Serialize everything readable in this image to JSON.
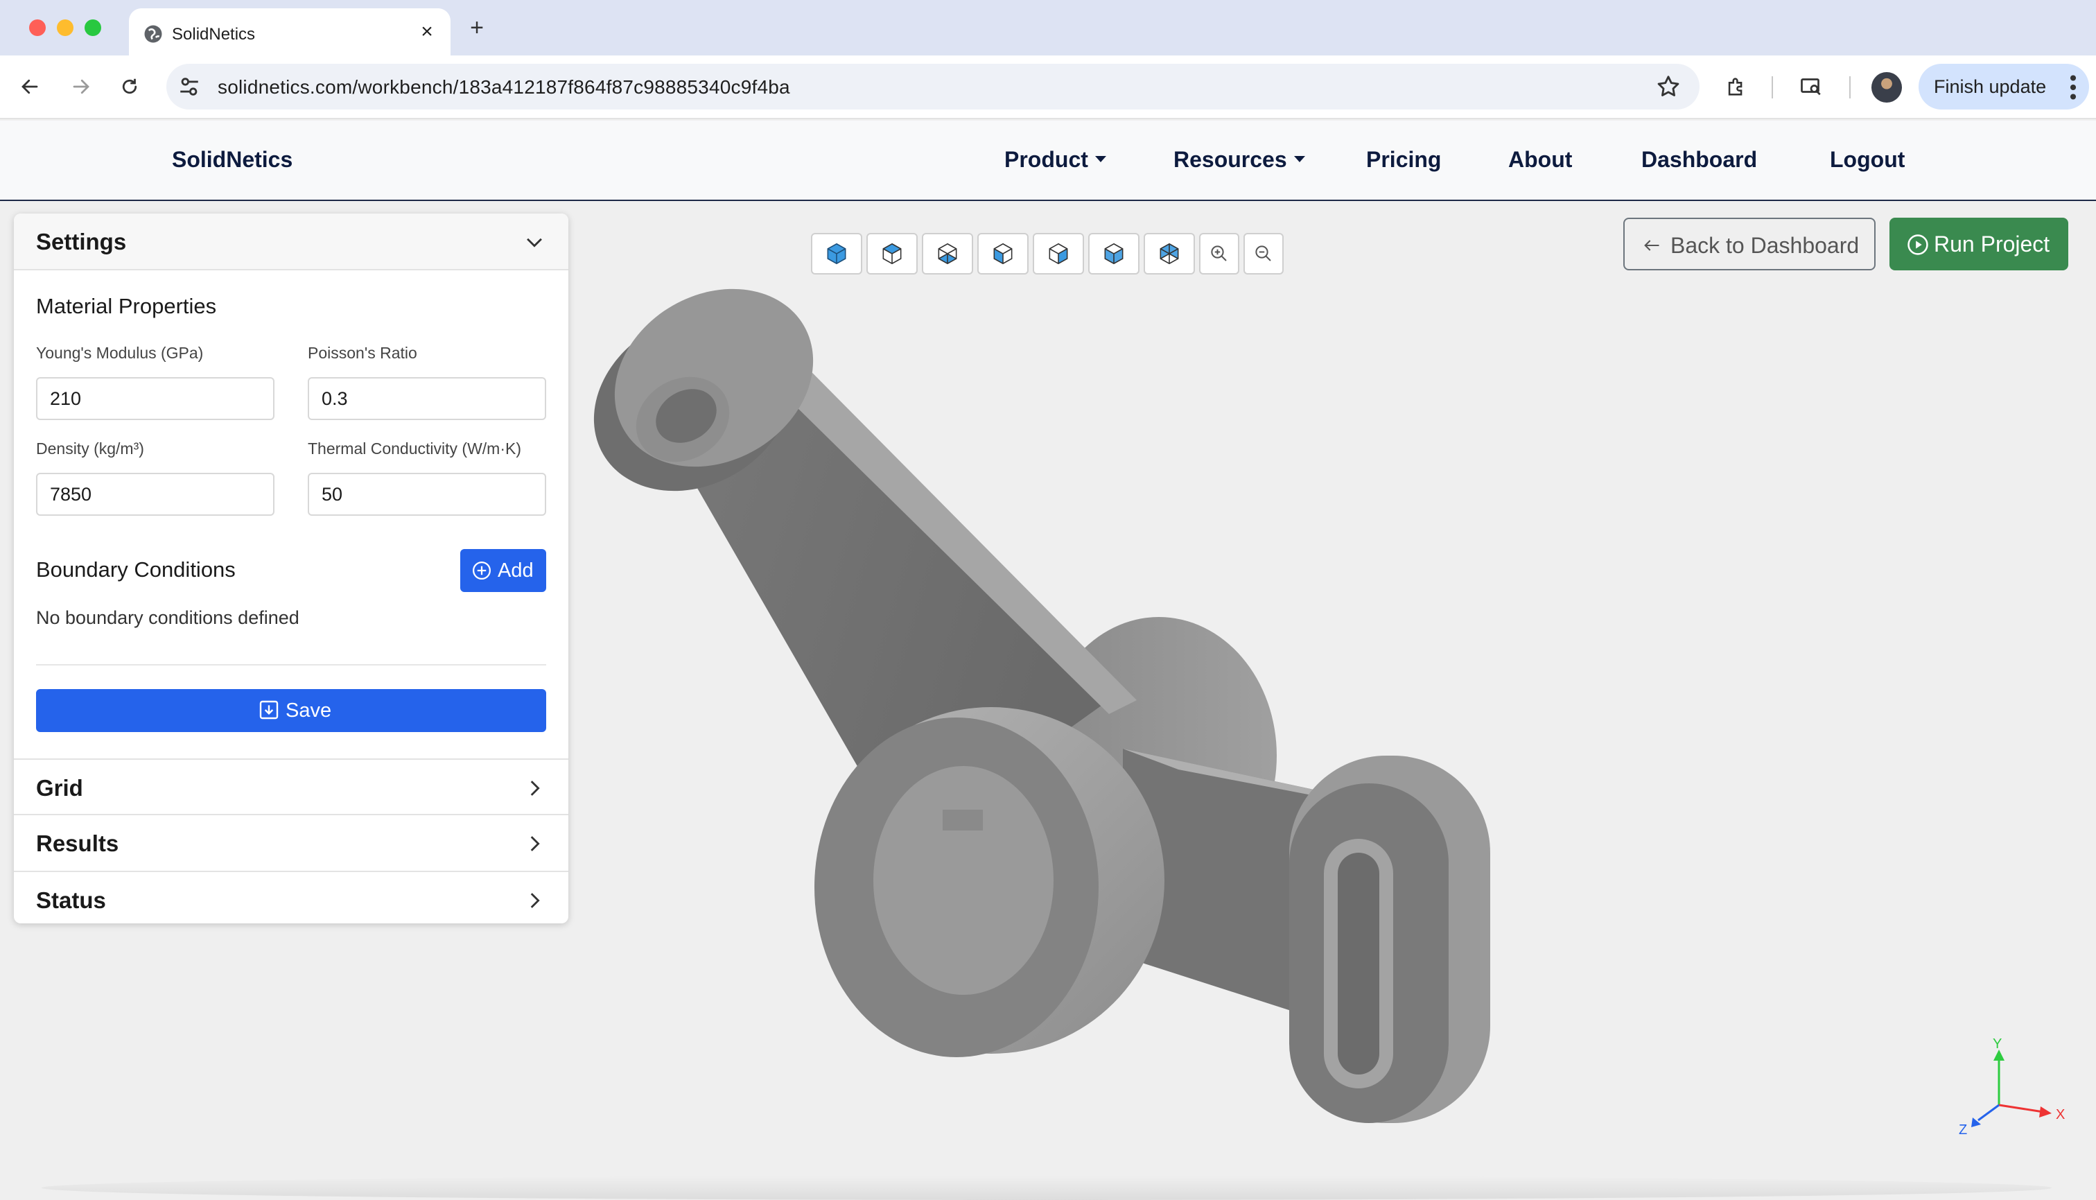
{
  "browser": {
    "tab_title": "SolidNetics",
    "url": "solidnetics.com/workbench/183a412187f864f87c98885340c9f4ba",
    "finish_update": "Finish update"
  },
  "nav": {
    "brand": "SolidNetics",
    "items": [
      "Product",
      "Resources",
      "Pricing",
      "About",
      "Dashboard",
      "Logout"
    ]
  },
  "settings": {
    "title": "Settings",
    "material_title": "Material Properties",
    "youngs_label": "Young's Modulus (GPa)",
    "youngs_value": "210",
    "poisson_label": "Poisson's Ratio",
    "poisson_value": "0.3",
    "density_label": "Density (kg/m³)",
    "density_value": "7850",
    "thermal_label": "Thermal Conductivity (W/m·K)",
    "thermal_value": "50",
    "bc_title": "Boundary Conditions",
    "add_label": "Add",
    "no_bc": "No boundary conditions defined",
    "save_label": "Save"
  },
  "accordion": {
    "grid": "Grid",
    "results": "Results",
    "status": "Status"
  },
  "actions": {
    "back": "Back to Dashboard",
    "run": "Run Project"
  },
  "axes": {
    "x": "X",
    "y": "Y",
    "z": "Z"
  },
  "colors": {
    "primary": "#2563eb",
    "success": "#3a8a4f",
    "navy": "#0d1b3e",
    "model_gray": "#8a8a8a"
  }
}
